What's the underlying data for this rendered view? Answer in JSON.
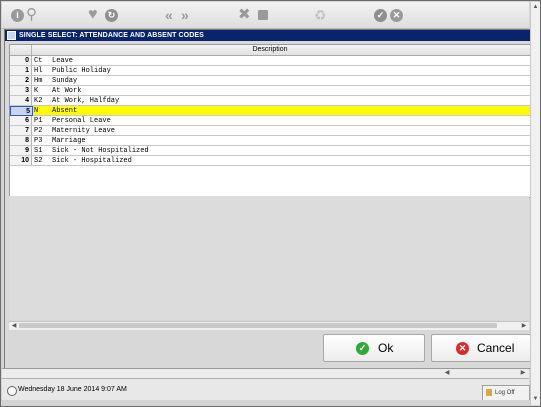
{
  "toolbar": {
    "icons": [
      "info-icon",
      "search-icon",
      "favorite-icon",
      "history-icon",
      "previous-icon",
      "next-icon",
      "tools-icon",
      "stop-icon",
      "recycle-icon",
      "accept-icon",
      "cancel-icon"
    ]
  },
  "dialog": {
    "title": "SINGLE SELECT: ATTENDANCE AND ABSENT CODES",
    "column_header": "Description",
    "rows": [
      {
        "num": "0",
        "code": "Ct",
        "desc": "Leave"
      },
      {
        "num": "1",
        "code": "Hl",
        "desc": "Public Holiday"
      },
      {
        "num": "2",
        "code": "Hm",
        "desc": "Sunday"
      },
      {
        "num": "3",
        "code": "K",
        "desc": "At Work"
      },
      {
        "num": "4",
        "code": "K2",
        "desc": "At Work, Halfday"
      },
      {
        "num": "5",
        "code": "N",
        "desc": "Absent"
      },
      {
        "num": "6",
        "code": "P1",
        "desc": "Personal Leave"
      },
      {
        "num": "7",
        "code": "P2",
        "desc": "Maternity Leave"
      },
      {
        "num": "8",
        "code": "P3",
        "desc": "Marriage"
      },
      {
        "num": "9",
        "code": "S1",
        "desc": "Sick - Not Hospitalized"
      },
      {
        "num": "10",
        "code": "S2",
        "desc": "Sick - Hospitalized"
      }
    ],
    "selected_index": 5,
    "ok_label": "Ok",
    "cancel_label": "Cancel"
  },
  "status": {
    "datetime": "Wednesday 18 June 2014 9:07 AM",
    "logoff_label": "Log Off"
  },
  "colors": {
    "titlebar": "#0a246a",
    "selected_row": "#ffff00",
    "ok_icon": "#2eaa36",
    "cancel_icon": "#d92b2b"
  }
}
